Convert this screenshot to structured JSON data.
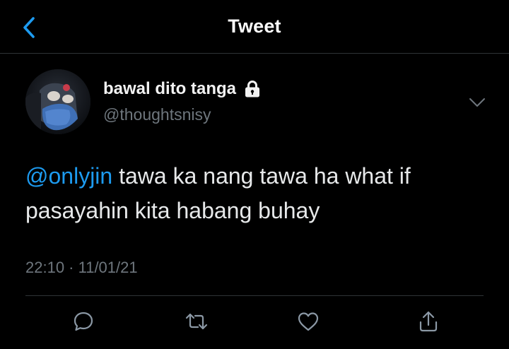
{
  "nav": {
    "title": "Tweet",
    "back_icon": "chevron-left-icon"
  },
  "author": {
    "display_name": "bawal dito tanga",
    "handle": "@thoughtsnisy",
    "protected_icon": "lock-icon"
  },
  "tweet": {
    "mention": "@onlyjin",
    "text": " tawa ka nang tawa ha what if pasayahin kita habang buhay",
    "timestamp": "22:10 · 11/01/21"
  },
  "actions": [
    {
      "name": "reply",
      "icon": "comment-icon"
    },
    {
      "name": "retweet",
      "icon": "retweet-icon"
    },
    {
      "name": "like",
      "icon": "heart-icon"
    },
    {
      "name": "share",
      "icon": "share-icon"
    }
  ],
  "colors": {
    "background": "#000000",
    "accent": "#1d9bf0",
    "secondary_text": "#6e767d",
    "divider": "#2f3336"
  }
}
